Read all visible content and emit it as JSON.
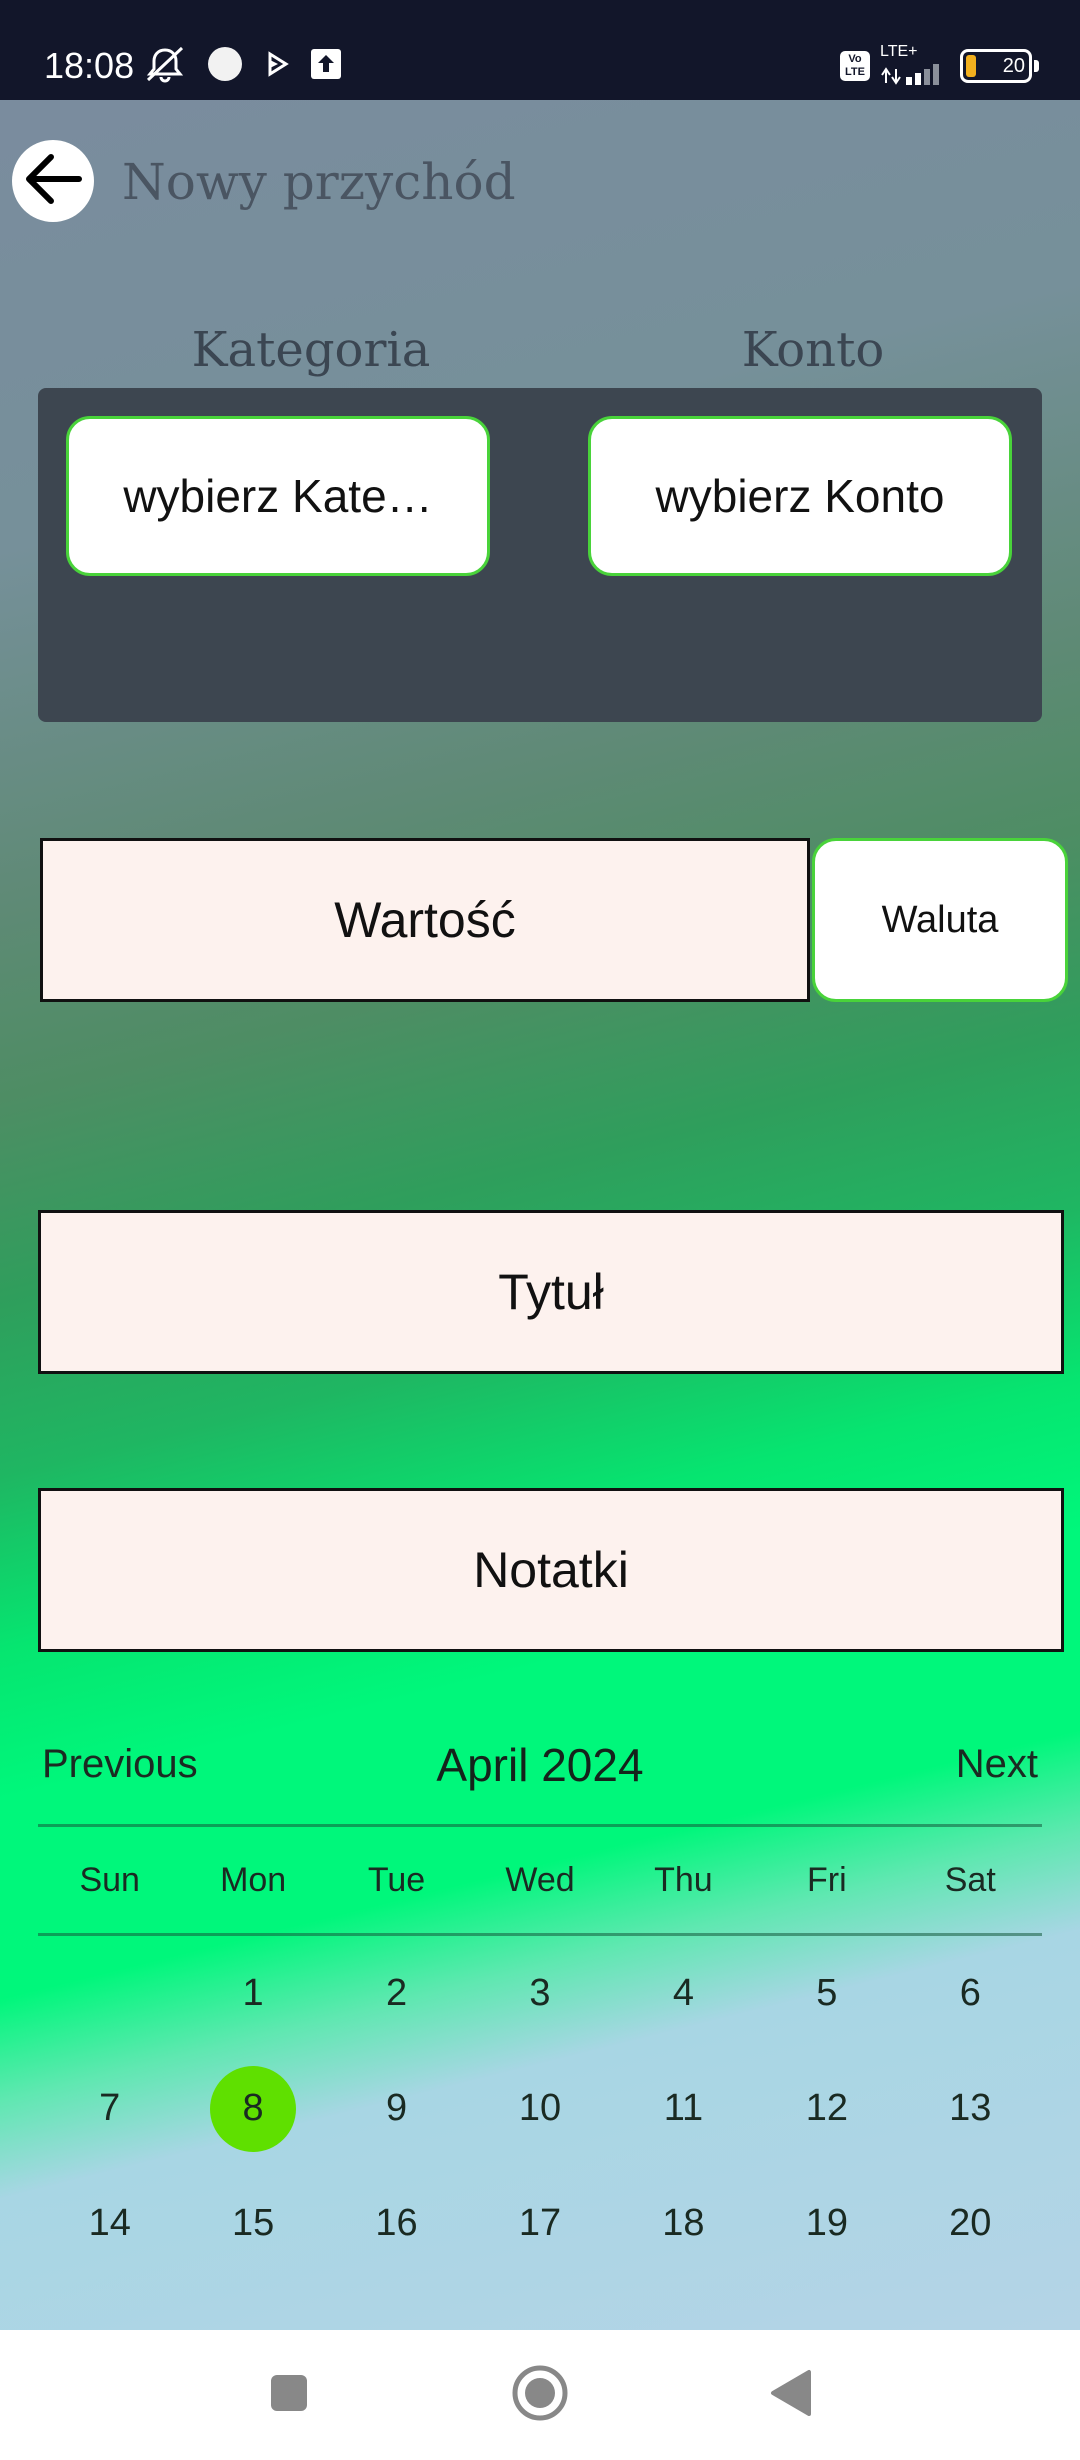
{
  "status_bar": {
    "time": "18:08",
    "network_label": "LTE+",
    "volte_label": "Vo LTE",
    "battery_level": "20",
    "battery_percent": 20,
    "icons": [
      "mute-icon",
      "dot-icon",
      "play-icon",
      "upload-icon",
      "volte-icon",
      "signal-icon",
      "battery-icon"
    ]
  },
  "header": {
    "title": "Nowy przychód",
    "back_icon": "arrow-left-icon"
  },
  "category_column": {
    "label": "Kategoria",
    "button_label": "wybierz Kate…"
  },
  "account_column": {
    "label": "Konto",
    "button_label": "wybierz Konto"
  },
  "amount": {
    "placeholder": "Wartość"
  },
  "currency": {
    "button_label": "Waluta"
  },
  "title_field": {
    "placeholder": "Tytuł"
  },
  "notes_field": {
    "placeholder": "Notatki"
  },
  "calendar": {
    "prev_label": "Previous",
    "next_label": "Next",
    "month_year": "April 2024",
    "weekdays": [
      "Sun",
      "Mon",
      "Tue",
      "Wed",
      "Thu",
      "Fri",
      "Sat"
    ],
    "leading_blank_days": 1,
    "days": [
      "1",
      "2",
      "3",
      "4",
      "5",
      "6",
      "7",
      "8",
      "9",
      "10",
      "11",
      "12",
      "13",
      "14",
      "15",
      "16",
      "17",
      "18",
      "19",
      "20"
    ],
    "selected_day": "8",
    "selected_color": "#5fe000"
  },
  "nav_bar": {
    "icons": [
      "recent-apps-icon",
      "home-icon",
      "back-icon"
    ]
  },
  "colors": {
    "accent_border": "#49d33a",
    "field_background": "#fdf2ee"
  }
}
